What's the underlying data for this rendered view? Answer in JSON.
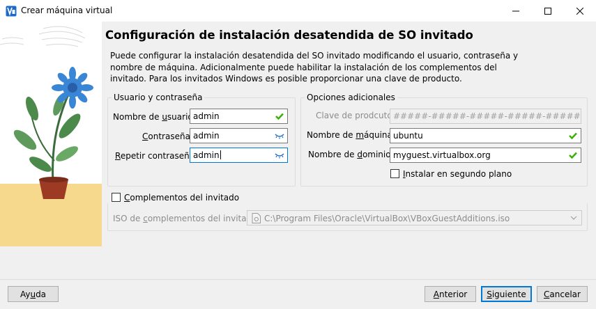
{
  "window": {
    "title": "Crear máquina virtual",
    "icon": "virtualbox-logo-icon"
  },
  "page": {
    "heading": "Configuración de instalación desatendida de SO invitado",
    "description": "Puede configurar la instalación desatendida del SO invitado modificando el usuario, contraseña y nombre de máquina. Adicionalmente puede habilitar la instalación de los complementos del invitado. Para los invitados Windows es posible proporcionar una clave de producto."
  },
  "user_group": {
    "title": "Usuario y contraseña",
    "username_label_pre": "Nombre de ",
    "username_label_u": "u",
    "username_label_post": "suario:",
    "username_value": "admin",
    "password_label_u": "C",
    "password_label_post": "ontraseña:",
    "password_value": "admin",
    "repeat_label_u": "R",
    "repeat_label_post": "epetir contraseña:",
    "repeat_value": "admin"
  },
  "options_group": {
    "title": "Opciones adicionales",
    "product_key_label": "Clave de prodcuto:",
    "product_key_placeholder": "#####-#####-#####-#####-#####",
    "hostname_label_pre": "Nombre de ",
    "hostname_label_u": "m",
    "hostname_label_post": "áquina:",
    "hostname_value": "ubuntu",
    "domain_label_pre": "Nombre de ",
    "domain_label_u": "d",
    "domain_label_post": "ominio:",
    "domain_value": "myguest.virtualbox.org",
    "background_label_u": "I",
    "background_label_post": "nstalar en segundo plano",
    "background_checked": false
  },
  "guest_additions": {
    "checkbox_label_u": "C",
    "checkbox_label_post": "omplementos del invitado",
    "checked": false,
    "iso_label_pre": "ISO de ",
    "iso_label_u": "c",
    "iso_label_post": "omplementos del invitado:",
    "iso_path": "C:\\Program Files\\Oracle\\VirtualBox\\VBoxGuestAdditions.iso"
  },
  "buttons": {
    "help_pre": "Ay",
    "help_u": "u",
    "help_post": "da",
    "back_u": "A",
    "back_post": "nterior",
    "next_u": "S",
    "next_post": "iguiente",
    "cancel_u": "C",
    "cancel_post": "ancelar"
  },
  "colors": {
    "accent": "#0078d7",
    "valid": "#38b000",
    "flower": "#3a86d6",
    "pot": "#9c3a24",
    "ground": "#f6d98c"
  }
}
